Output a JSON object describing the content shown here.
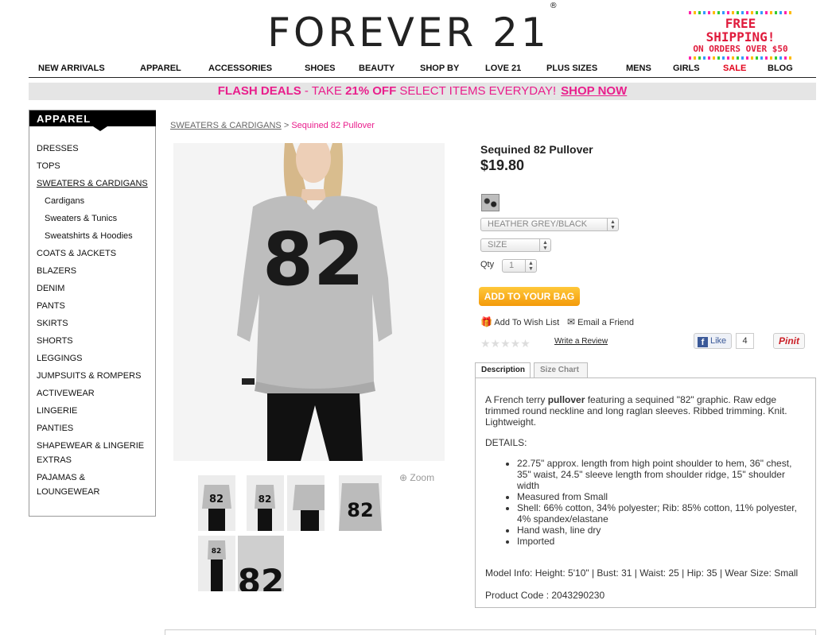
{
  "header": {
    "logo": "FOREVER 21",
    "logo_mark": "®",
    "free_shipping_line1": "FREE SHIPPING!",
    "free_shipping_line2": "ON ORDERS OVER $50"
  },
  "nav": [
    "NEW ARRIVALS",
    "APPAREL",
    "ACCESSORIES",
    "SHOES",
    "BEAUTY",
    "SHOP BY",
    "LOVE 21",
    "PLUS SIZES",
    "MENS",
    "GIRLS",
    "SALE",
    "BLOG"
  ],
  "flash": {
    "label": "FLASH DEALS",
    "text1": " - TAKE ",
    "pct": "21% OFF",
    "text2": " SELECT ITEMS EVERYDAY!",
    "cta": "SHOP NOW"
  },
  "sidebar": {
    "title": "APPAREL",
    "items": [
      "DRESSES",
      "TOPS",
      "SWEATERS & CARDIGANS",
      "Cardigans",
      "Sweaters & Tunics",
      "Sweatshirts & Hoodies",
      "COATS & JACKETS",
      "BLAZERS",
      "DENIM",
      "PANTS",
      "SKIRTS",
      "SHORTS",
      "LEGGINGS",
      "JUMPSUITS & ROMPERS",
      "ACTIVEWEAR",
      "LINGERIE",
      "PANTIES",
      "SHAPEWEAR & LINGERIE",
      "EXTRAS",
      "PAJAMAS &",
      "LOUNGEWEAR"
    ]
  },
  "breadcrumb": {
    "parent": "SWEATERS & CARDIGANS",
    "sep": " > ",
    "current": "Sequined 82 Pullover"
  },
  "product": {
    "title": "Sequined 82 Pullover",
    "price": "$19.80",
    "color_select": "HEATHER GREY/BLACK",
    "size_select": "SIZE",
    "qty_label": "Qty",
    "qty_value": "1",
    "add_to_bag": "ADD TO YOUR BAG",
    "wishlist": "Add To Wish List",
    "email_friend": "Email a Friend",
    "write_review": "Write a Review",
    "like_label": "Like",
    "like_count": "4",
    "pin_label": "Pinit",
    "zoom_label": "Zoom",
    "number_graphic": "82",
    "rating_stars": "★★★★★"
  },
  "tabs": [
    "Description",
    "Size Chart"
  ],
  "description": {
    "intro_pre": "A French terry ",
    "intro_bold": "pullover",
    "intro_post": " featuring a sequined \"82\" graphic. Raw edge trimmed round neckline and long raglan sleeves. Ribbed trimming. Knit. Lightweight.",
    "details_label": "DETAILS:",
    "bullets": [
      "22.75\" approx. length from high point shoulder to hem, 36\" chest, 35\" waist, 24.5\" sleeve length from shoulder ridge, 15\" shoulder width",
      "Measured from Small",
      "Shell: 66% cotton, 34% polyester; Rib: 85% cotton, 11% polyester, 4% spandex/elastane",
      "Hand wash, line dry",
      "Imported"
    ],
    "model_info": "Model Info: Height: 5'10\" | Bust: 31 | Waist: 25 | Hip: 35 | Wear Size: Small",
    "product_code": "Product Code : 2043290230"
  },
  "colors": {
    "accent_pink": "#e91e8c",
    "sale_red": "#e2001a",
    "button_orange": "#f39a0a"
  }
}
